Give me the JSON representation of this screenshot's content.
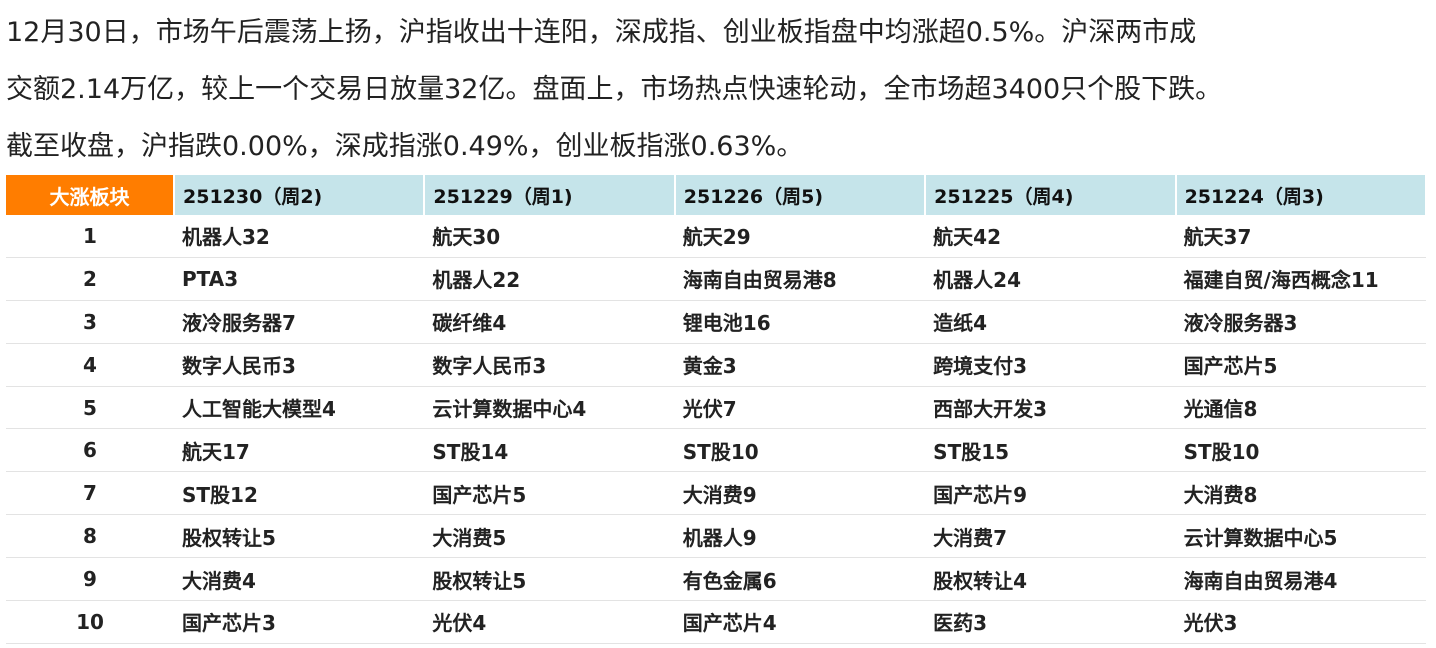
{
  "intro": {
    "lines": [
      "12月30日，市场午后震荡上扬，沪指收出十连阳，深成指、创业板指盘中均涨超0.5%。沪深两市成",
      "交额2.14万亿，较上一个交易日放量32亿。盘面上，市场热点快速轮动，全市场超3400只个股下跌。",
      "截至收盘，沪指跌0.00%，深成指涨0.49%，创业板指涨0.63%。"
    ]
  },
  "table": {
    "corner_label": "大涨板块",
    "columns": [
      "251230（周2)",
      "251229（周1)",
      "251226（周5)",
      "251225（周4)",
      "251224（周3)"
    ],
    "rows": [
      {
        "rank": "1",
        "cells": [
          {
            "text": "机器人32",
            "color": "orange"
          },
          {
            "text": "航天30",
            "color": "gold"
          },
          {
            "text": "航天29",
            "color": "gold"
          },
          {
            "text": "航天42",
            "color": "gold"
          },
          {
            "text": "航天37",
            "color": "gold"
          }
        ]
      },
      {
        "rank": "2",
        "cells": [
          {
            "text": "PTA3",
            "color": "black"
          },
          {
            "text": "机器人22",
            "color": "orange"
          },
          {
            "text": "海南自由贸易港8",
            "color": "purple"
          },
          {
            "text": "机器人24",
            "color": "black"
          },
          {
            "text": "福建自贸/海西概念11",
            "color": "blue"
          }
        ]
      },
      {
        "rank": "3",
        "cells": [
          {
            "text": "液冷服务器7",
            "color": "black"
          },
          {
            "text": "碳纤维4",
            "color": "black"
          },
          {
            "text": "锂电池16",
            "color": "black"
          },
          {
            "text": "造纸4",
            "color": "black"
          },
          {
            "text": "液冷服务器3",
            "color": "brown"
          }
        ]
      },
      {
        "rank": "4",
        "cells": [
          {
            "text": "数字人民币3",
            "color": "black"
          },
          {
            "text": "数字人民币3",
            "color": "black"
          },
          {
            "text": "黄金3",
            "color": "black"
          },
          {
            "text": "跨境支付3",
            "color": "black"
          },
          {
            "text": "国产芯片5",
            "color": "blue"
          }
        ]
      },
      {
        "rank": "5",
        "cells": [
          {
            "text": "人工智能大模型4",
            "color": "black"
          },
          {
            "text": "云计算数据中心4",
            "color": "black"
          },
          {
            "text": "光伏7",
            "color": "black"
          },
          {
            "text": "西部大开发3",
            "color": "black"
          },
          {
            "text": "光通信8",
            "color": "red"
          }
        ]
      },
      {
        "rank": "6",
        "cells": [
          {
            "text": "航天17",
            "color": "gold"
          },
          {
            "text": "ST股14",
            "color": "black"
          },
          {
            "text": "ST股10",
            "color": "black"
          },
          {
            "text": "ST股15",
            "color": "black"
          },
          {
            "text": "ST股10",
            "color": "black"
          }
        ]
      },
      {
        "rank": "7",
        "cells": [
          {
            "text": "ST股12",
            "color": "black"
          },
          {
            "text": "国产芯片5",
            "color": "blue"
          },
          {
            "text": "大消费9",
            "color": "cyan"
          },
          {
            "text": "国产芯片9",
            "color": "blue"
          },
          {
            "text": "大消费8",
            "color": "cyan"
          }
        ]
      },
      {
        "rank": "8",
        "cells": [
          {
            "text": "股权转让5",
            "color": "black"
          },
          {
            "text": "大消费5",
            "color": "cyan"
          },
          {
            "text": "机器人9",
            "color": "orange"
          },
          {
            "text": "大消费7",
            "color": "cyan"
          },
          {
            "text": "云计算数据中心5",
            "color": "black"
          }
        ]
      },
      {
        "rank": "9",
        "cells": [
          {
            "text": "大消费4",
            "color": "cyan"
          },
          {
            "text": "股权转让5",
            "color": "black"
          },
          {
            "text": "有色金属6",
            "color": "black"
          },
          {
            "text": "股权转让4",
            "color": "black"
          },
          {
            "text": "海南自由贸易港4",
            "color": "purple"
          }
        ]
      },
      {
        "rank": "10",
        "cells": [
          {
            "text": "国产芯片3",
            "color": "blue"
          },
          {
            "text": "光伏4",
            "color": "black"
          },
          {
            "text": "国产芯片4",
            "color": "blue"
          },
          {
            "text": "医药3",
            "color": "black"
          },
          {
            "text": "光伏3",
            "color": "black"
          }
        ]
      }
    ]
  },
  "colors": {
    "header_bg": "#c5e4ea",
    "corner_bg": "#ff7d00",
    "orange": "#f5821f",
    "gold": "#f5c400",
    "purple": "#a25ed8",
    "blue": "#4fa3e0",
    "brown": "#b8862b",
    "red": "#ff1e1e",
    "cyan": "#29c2e8",
    "black": "#222222"
  }
}
